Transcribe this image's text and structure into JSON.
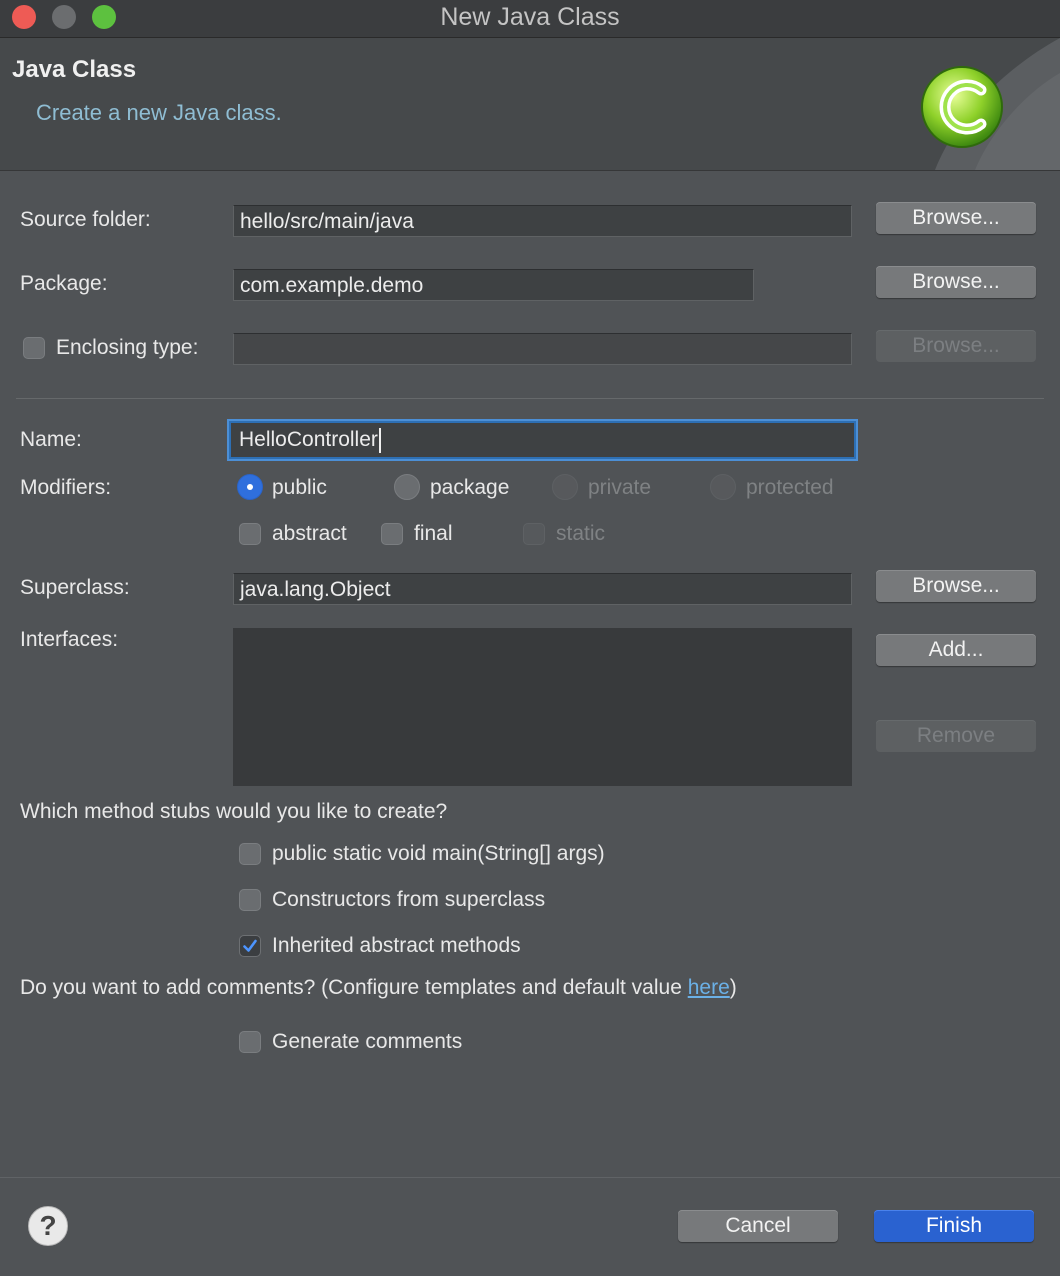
{
  "window": {
    "title": "New Java Class"
  },
  "header": {
    "title": "Java Class",
    "description": "Create a new Java class.",
    "icon": "java-class-c-icon"
  },
  "form": {
    "source_folder": {
      "label": "Source folder:",
      "value": "hello/src/main/java",
      "browse": "Browse..."
    },
    "package": {
      "label": "Package:",
      "value": "com.example.demo",
      "browse": "Browse..."
    },
    "enclosing_type": {
      "label": "Enclosing type:",
      "value": "",
      "checked": false,
      "browse": "Browse..."
    },
    "name": {
      "label": "Name:",
      "value": "HelloController"
    },
    "modifiers": {
      "label": "Modifiers:",
      "visibility": [
        "public",
        "package",
        "private",
        "protected"
      ],
      "selected": "public",
      "abstract": "abstract",
      "final": "final",
      "static": "static"
    },
    "superclass": {
      "label": "Superclass:",
      "value": "java.lang.Object",
      "browse": "Browse..."
    },
    "interfaces": {
      "label": "Interfaces:",
      "add": "Add...",
      "remove": "Remove",
      "items": []
    },
    "stubs": {
      "question": "Which method stubs would you like to create?",
      "main": "public static void main(String[] args)",
      "constructors": "Constructors from superclass",
      "inherited": "Inherited abstract methods",
      "inherited_checked": true
    },
    "comments": {
      "question_prefix": "Do you want to add comments? (Configure templates and default value ",
      "link": "here",
      "question_suffix": ")",
      "generate": "Generate comments"
    }
  },
  "footer": {
    "help": "?",
    "cancel": "Cancel",
    "finish": "Finish"
  },
  "colors": {
    "accent": "#2a62d0",
    "link": "#6bb0e6",
    "description": "#8fbdd3"
  }
}
